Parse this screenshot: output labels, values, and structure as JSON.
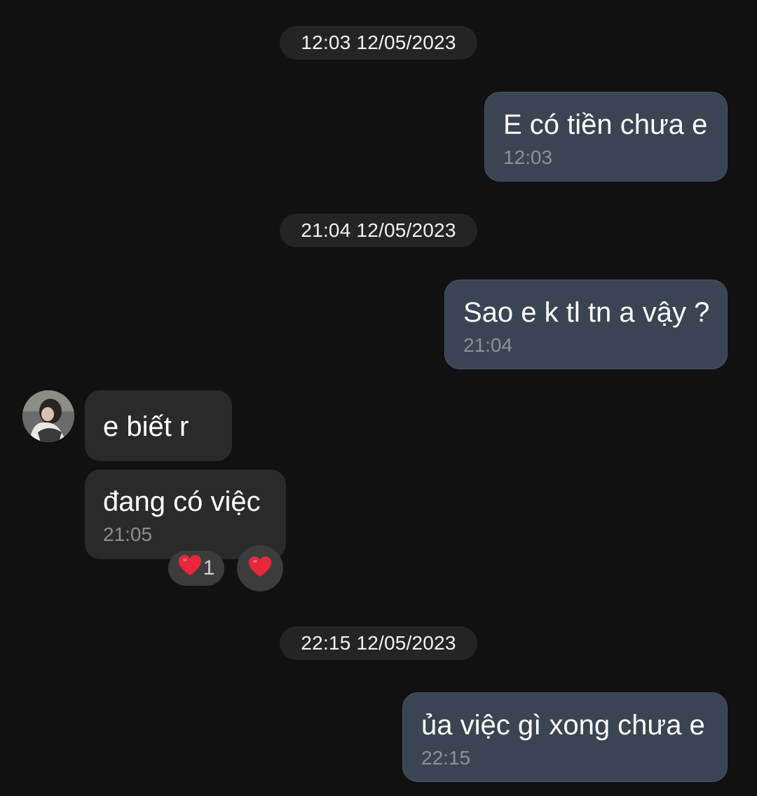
{
  "conversation": {
    "date_separators": [
      {
        "label": "12:03 12/05/2023"
      },
      {
        "label": "21:04 12/05/2023"
      },
      {
        "label": "22:15 12/05/2023"
      }
    ],
    "messages": [
      {
        "direction": "outgoing",
        "text": "E có tiền chưa e",
        "time": "12:03"
      },
      {
        "direction": "outgoing",
        "text": "Sao e k tl tn a vậy ?",
        "time": "21:04"
      },
      {
        "direction": "incoming",
        "text": "e biết r"
      },
      {
        "direction": "incoming",
        "text": "đang có việc",
        "time": "21:05",
        "reactions": {
          "heart_count": "1"
        }
      },
      {
        "direction": "outgoing",
        "text": "ủa việc gì xong chưa e",
        "time": "22:15"
      }
    ]
  },
  "icons": {
    "reaction_heart": "heart-icon",
    "react_button": "heart-icon"
  },
  "colors": {
    "background": "#111112",
    "outgoing_bubble": "#3b4452",
    "incoming_bubble": "#2a2a2a",
    "date_pill": "#242424",
    "heart": "#e8273a"
  }
}
